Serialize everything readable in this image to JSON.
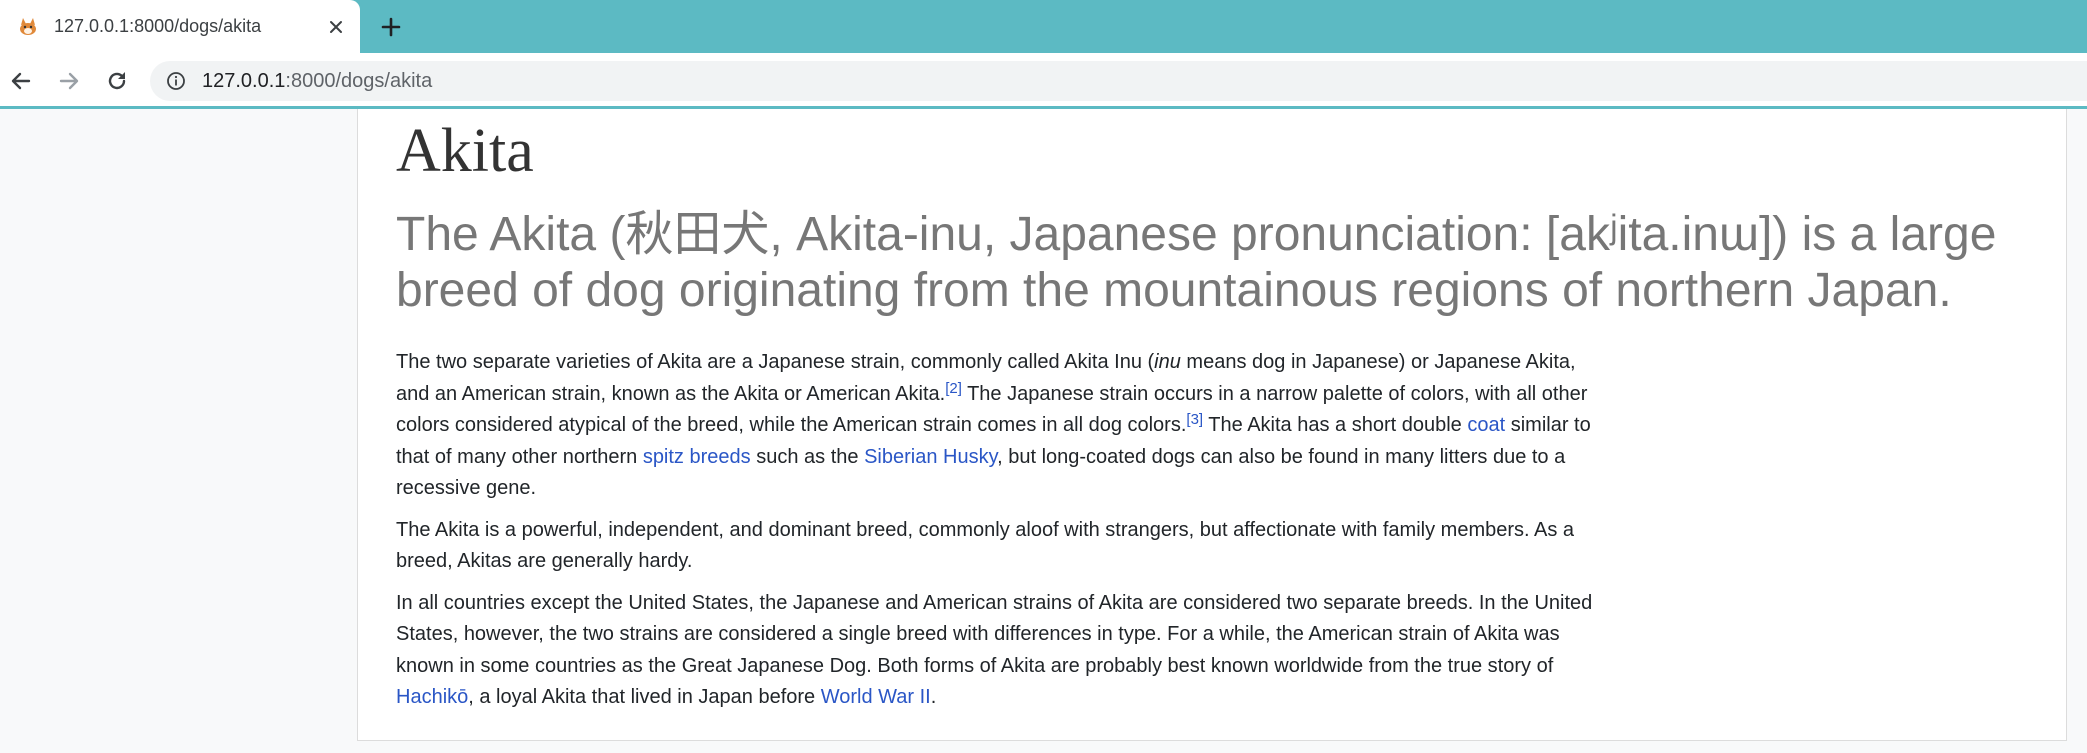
{
  "browser": {
    "tab": {
      "title": "127.0.0.1:8000/dogs/akita",
      "favicon": "dog-favicon-icon",
      "close_icon": "close-icon"
    },
    "new_tab_icon": "plus-icon",
    "nav": {
      "back_icon": "arrow-left-icon",
      "forward_icon": "arrow-right-icon",
      "reload_icon": "reload-icon"
    },
    "address_bar": {
      "info_icon": "info-icon",
      "host": "127.0.0.1",
      "path": ":8000/dogs/akita"
    },
    "colors": {
      "frame": "#5cbac3",
      "link": "#2a56c6",
      "lead_text": "#777777"
    }
  },
  "article": {
    "title": "Akita",
    "lead": "The Akita (秋田犬, Akita-inu, Japanese pronunciation: [akʲita.inɯ]) is a large breed of dog originating from the mountainous regions of northern Japan.",
    "p1": {
      "t1": "The two separate varieties of Akita are a Japanese strain, commonly called Akita Inu (",
      "t1_em": "inu",
      "t2": " means dog in Japanese) or Japanese Akita, and an American strain, known as the Akita or American Akita.",
      "ref1": "[2]",
      "t3": " The Japanese strain occurs in a narrow palette of colors, with all other colors considered atypical of the breed, while the American strain comes in all dog colors.",
      "ref2": "[3]",
      "t4": " The Akita has a short double ",
      "link_coat": "coat",
      "t5": " similar to that of many other northern ",
      "link_spitz": "spitz breeds",
      "t6": " such as the ",
      "link_husky": "Siberian Husky",
      "t7": ", but long-coated dogs can also be found in many litters due to a recessive gene."
    },
    "p2": "The Akita is a powerful, independent, and dominant breed, commonly aloof with strangers, but affectionate with family members. As a breed, Akitas are generally hardy.",
    "p3": {
      "t1": "In all countries except the United States, the Japanese and American strains of Akita are considered two separate breeds. In the United States, however, the two strains are considered a single breed with differences in type. For a while, the American strain of Akita was known in some countries as the Great Japanese Dog. Both forms of Akita are probably best known worldwide from the true story of ",
      "link_hachiko": "Hachikō",
      "t2": ", a loyal Akita that lived in Japan before ",
      "link_ww2": "World War II",
      "t3": "."
    }
  }
}
